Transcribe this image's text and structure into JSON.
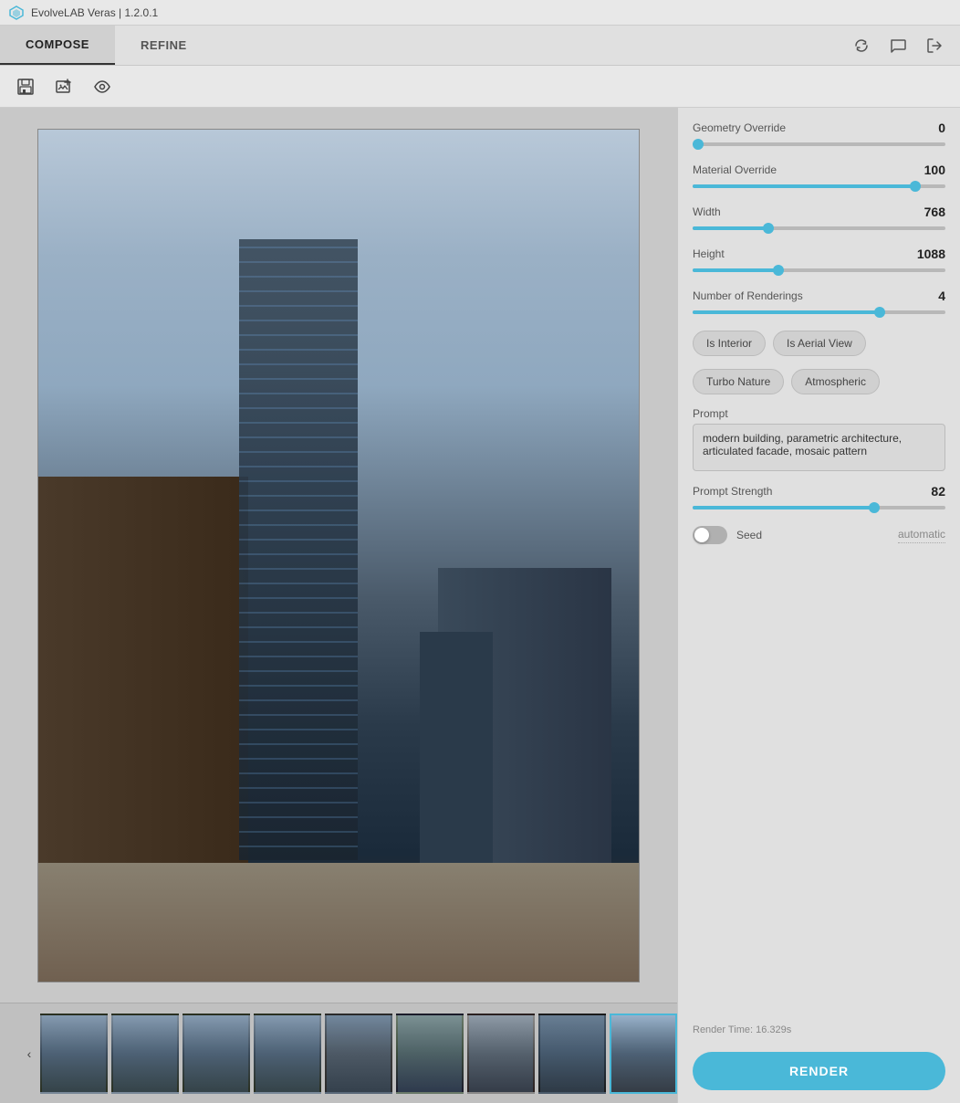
{
  "titleBar": {
    "icon": "✦",
    "title": "EvolveLAB Veras | 1.2.0.1"
  },
  "tabs": {
    "items": [
      {
        "id": "compose",
        "label": "COMPOSE",
        "active": true
      },
      {
        "id": "refine",
        "label": "REFINE",
        "active": false
      }
    ],
    "actions": {
      "sync": "⇄",
      "chat": "💬",
      "logout": "↪"
    }
  },
  "toolbar": {
    "save_icon": "💾",
    "addimage_icon": "🖼",
    "eye_icon": "👁"
  },
  "controls": {
    "geometry_override": {
      "label": "Geometry Override",
      "value": "0",
      "fill_pct": 2
    },
    "material_override": {
      "label": "Material Override",
      "value": "100",
      "fill_pct": 88
    },
    "width": {
      "label": "Width",
      "value": "768",
      "fill_pct": 30
    },
    "height": {
      "label": "Height",
      "value": "1088",
      "fill_pct": 34
    },
    "number_of_renderings": {
      "label": "Number of Renderings",
      "value": "4",
      "fill_pct": 74
    }
  },
  "tags": [
    {
      "id": "is-interior",
      "label": "Is Interior"
    },
    {
      "id": "is-aerial-view",
      "label": "Is Aerial View"
    },
    {
      "id": "turbo-nature",
      "label": "Turbo Nature"
    },
    {
      "id": "atmospheric",
      "label": "Atmospheric"
    }
  ],
  "prompt": {
    "label": "Prompt",
    "value": "modern building, parametric architecture, articulated facade, mosaic pattern"
  },
  "prompt_strength": {
    "label": "Prompt Strength",
    "value": "82",
    "fill_pct": 72
  },
  "seed": {
    "label": "Seed",
    "value": "automatic",
    "enabled": false
  },
  "render_time": {
    "label": "Render Time: 16.329s"
  },
  "render_button": {
    "label": "RENDER"
  },
  "thumbnails": {
    "count": 9,
    "active_index": 8,
    "prev": "‹",
    "next": "›"
  }
}
